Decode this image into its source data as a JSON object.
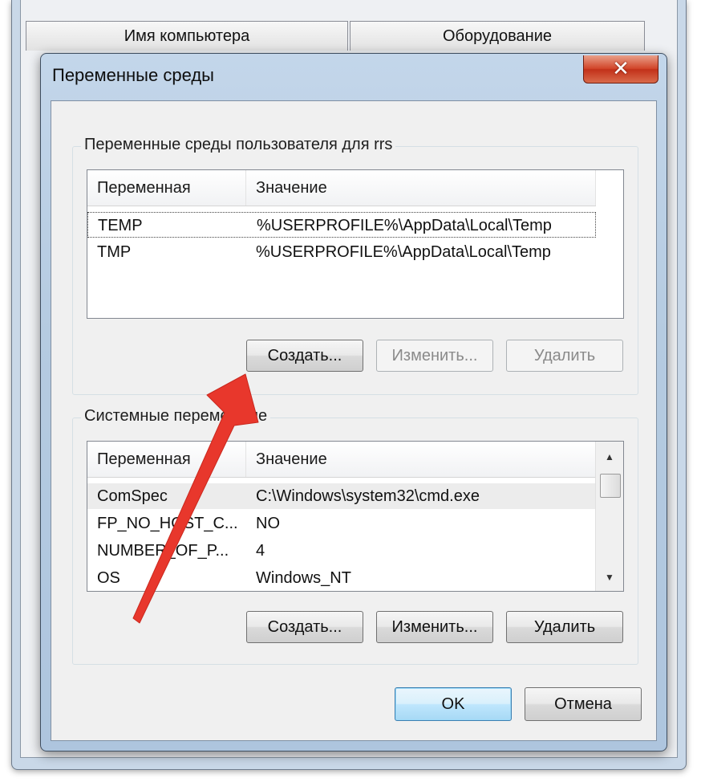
{
  "parent": {
    "tab_computer_name": "Имя компьютера",
    "tab_hardware": "Оборудование"
  },
  "dialog": {
    "title": "Переменные среды",
    "close_label": "✕"
  },
  "user_vars": {
    "legend": "Переменные среды пользователя для rrs",
    "columns": [
      "Переменная",
      "Значение"
    ],
    "rows": [
      {
        "name": "TEMP",
        "value": "%USERPROFILE%\\AppData\\Local\\Temp"
      },
      {
        "name": "TMP",
        "value": "%USERPROFILE%\\AppData\\Local\\Temp"
      }
    ],
    "buttons": {
      "create": "Создать...",
      "edit": "Изменить...",
      "delete": "Удалить"
    }
  },
  "system_vars": {
    "legend": "Системные переменные",
    "columns": [
      "Переменная",
      "Значение"
    ],
    "rows": [
      {
        "name": "ComSpec",
        "value": "C:\\Windows\\system32\\cmd.exe"
      },
      {
        "name": "FP_NO_HOST_C...",
        "value": "NO"
      },
      {
        "name": "NUMBER_OF_P...",
        "value": "4"
      },
      {
        "name": "OS",
        "value": "Windows_NT"
      }
    ],
    "buttons": {
      "create": "Создать...",
      "edit": "Изменить...",
      "delete": "Удалить"
    }
  },
  "footer": {
    "ok": "OK",
    "cancel": "Отмена"
  },
  "colors": {
    "annotation_arrow": "#e8372c",
    "close_button": "#c7361e",
    "default_button_border": "#3c7fb1"
  }
}
